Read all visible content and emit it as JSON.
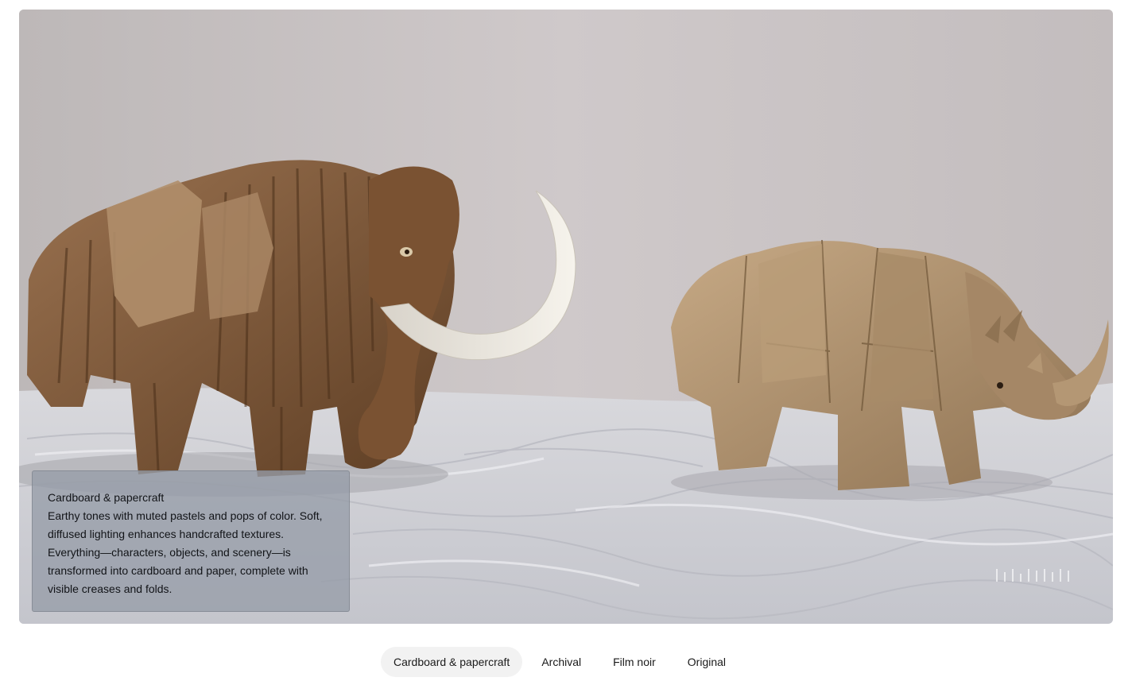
{
  "caption": {
    "title": "Cardboard & papercraft",
    "body": "Earthy tones with muted pastels and pops of color. Soft, diffused lighting enhances handcrafted textures. Everything—characters, objects, and scenery—is transformed into cardboard and paper, complete with visible creases and folds."
  },
  "tabs": [
    {
      "label": "Cardboard & papercraft",
      "active": true
    },
    {
      "label": "Archival",
      "active": false
    },
    {
      "label": "Film noir",
      "active": false
    },
    {
      "label": "Original",
      "active": false
    }
  ],
  "colors": {
    "mammoth_fur": "#7a5535",
    "paper_tan": "#b89a77",
    "tusk": "#ece8e0",
    "tab_active_bg": "#f2f2f2"
  }
}
